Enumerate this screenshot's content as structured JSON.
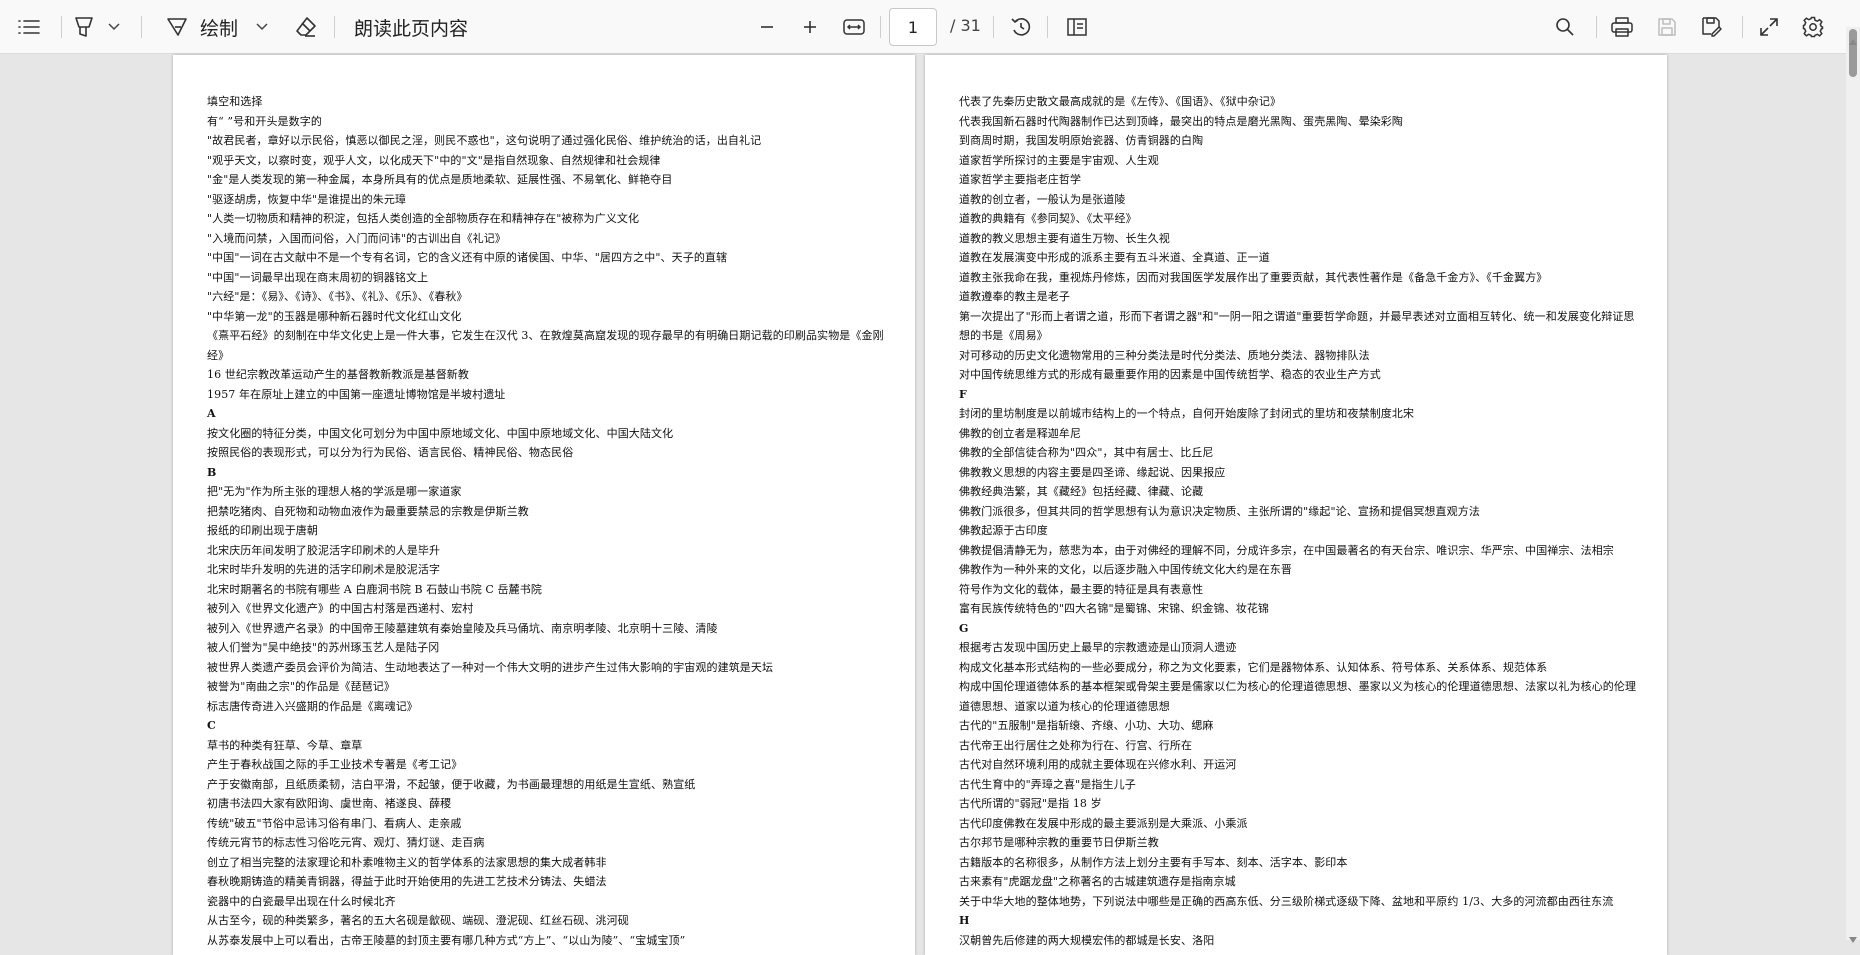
{
  "toolbar": {
    "draw_label": "绘制",
    "read_aloud_label": "朗读此页内容",
    "page_current": "1",
    "page_total": "/ 31"
  },
  "icons": [
    "contents-icon",
    "highlight-icon",
    "chevron-down-icon",
    "draw-icon",
    "chevron-down-icon",
    "eraser-icon",
    "zoom-out-icon",
    "zoom-in-icon",
    "fit-width-icon",
    "rotate-icon",
    "page-view-icon",
    "search-icon",
    "print-icon",
    "save-icon",
    "save-as-icon",
    "fullscreen-icon",
    "gear-icon"
  ],
  "left_page": {
    "lines": [
      {
        "text": "填空和选择"
      },
      {
        "text": "有“ ”号和开头是数字的"
      },
      {
        "text": "\"故君民者，章好以示民俗，慎恶以御民之淫，则民不惑也\"，这句说明了通过强化民俗、维护统治的话，出自礼记"
      },
      {
        "text": "\"观乎天文，以察时变，观乎人文，以化成天下\"中的\"文\"是指自然现象、自然规律和社会规律"
      },
      {
        "text": "\"金\"是人类发现的第一种金属，本身所具有的优点是质地柔软、延展性强、不易氧化、鲜艳夺目"
      },
      {
        "text": "\"驱逐胡虏，恢复中华\"是谁提出的朱元璋"
      },
      {
        "text": "\"人类一切物质和精神的积淀，包括人类创造的全部物质存在和精神存在\"被称为广义文化"
      },
      {
        "text": "\"入境而问禁，入国而问俗，入门而问讳\"的古训出自《礼记》"
      },
      {
        "text": "\"中国\"一词在古文献中不是一个专有名词，它的含义还有中原的诸侯国、中华、\"居四方之中\"、天子的直辖"
      },
      {
        "text": "\"中国\"一词最早出现在商末周初的铜器铭文上"
      },
      {
        "text": " \"六经\"是：《易》、《诗》、《书》、《礼》、《乐》、《春秋》"
      },
      {
        "text": " \"中华第一龙\"的玉器是哪种新石器时代文化红山文化"
      },
      {
        "text": "《熹平石经》的刻制在中华文化史上是一件大事，它发生在汉代 3、在敦煌莫高窟发现的现存最早的有明确日期记载的印刷品实物是《金刚经》",
        "wrap": true
      },
      {
        "text": "16 世纪宗教改革运动产生的基督教新教派是基督新教"
      },
      {
        "text": "1957 年在原址上建立的中国第一座遗址博物馆是半坡村遗址"
      },
      {
        "text": "A",
        "hdr": true
      },
      {
        "text": "按文化圈的特征分类，中国文化可划分为中国中原地域文化、中国中原地域文化、中国大陆文化"
      },
      {
        "text": "按照民俗的表现形式，可以分为行为民俗、语言民俗、精神民俗、物态民俗"
      },
      {
        "text": "B",
        "hdr": true
      },
      {
        "text": "把\"无为\"作为所主张的理想人格的学派是哪一家道家"
      },
      {
        "text": "把禁吃猪肉、自死物和动物血液作为最重要禁忌的宗教是伊斯兰教"
      },
      {
        "text": "报纸的印刷出现于唐朝"
      },
      {
        "text": "北宋庆历年间发明了胶泥活字印刷术的人是毕升"
      },
      {
        "text": "北宋时毕升发明的先进的活字印刷术是胶泥活字"
      },
      {
        "text": "北宋时期著名的书院有哪些 A 白鹿洞书院 B 石鼓山书院 C 岳麓书院"
      },
      {
        "text": "被列入《世界文化遗产》的中国古村落是西递村、宏村"
      },
      {
        "text": "被列入《世界遗产名录》的中国帝王陵墓建筑有秦始皇陵及兵马俑坑、南京明孝陵、北京明十三陵、清陵"
      },
      {
        "text": "被人们誉为\"吴中绝技\"的苏州琢玉艺人是陆子冈"
      },
      {
        "text": "被世界人类遗产委员会评价为简洁、生动地表达了一种对一个伟大文明的进步产生过伟大影响的宇宙观的建筑是天坛"
      },
      {
        "text": "被誉为\"南曲之宗\"的作品是《琵琶记》"
      },
      {
        "text": "标志唐传奇进入兴盛期的作品是《离魂记》"
      },
      {
        "text": "C",
        "hdr": true
      },
      {
        "text": "草书的种类有狂草、今草、章草"
      },
      {
        "text": "产生于春秋战国之际的手工业技术专著是《考工记》"
      },
      {
        "text": "产于安徽南部，且纸质柔韧，洁白平滑，不起皱，便于收藏，为书画最理想的用纸是生宣纸、熟宣纸"
      },
      {
        "text": "初唐书法四大家有欧阳询、虞世南、褚遂良、薛稷"
      },
      {
        "text": "传统\"破五\"节俗中忌讳习俗有串门、看病人、走亲戚"
      },
      {
        "text": "传统元宵节的标志性习俗吃元宵、观灯、猜灯谜、走百病"
      },
      {
        "text": "创立了相当完整的法家理论和朴素唯物主义的哲学体系的法家思想的集大成者韩非"
      },
      {
        "text": "春秋晚期铸造的精美青铜器，得益于此时开始使用的先进工艺技术分铸法、失蜡法"
      },
      {
        "text": "瓷器中的白瓷最早出现在什么时候北齐"
      },
      {
        "text": "从古至今，砚的种类繁多，著名的五大名砚是歙砚、端砚、澄泥砚、红丝石砚、洮河砚"
      },
      {
        "text": "从苏泰发展中上可以看出，古帝王陵墓的封顶主要有哪几种方式“方上”、“以山为陵”、“宝城宝顶”"
      }
    ]
  },
  "right_page": {
    "lines": [
      {
        "text": "代表了先秦历史散文最高成就的是《左传》、《国语》、《狱中杂记》"
      },
      {
        "text": "代表我国新石器时代陶器制作已达到顶峰，最突出的特点是磨光黑陶、蛋壳黑陶、晕染彩陶"
      },
      {
        "text": "到商周时期，我国发明原始瓷器、仿青铜器的白陶"
      },
      {
        "text": "道家哲学所探讨的主要是宇宙观、人生观"
      },
      {
        "text": "道家哲学主要指老庄哲学"
      },
      {
        "text": "道教的创立者，一般认为是张道陵"
      },
      {
        "text": "道教的典籍有《参同契》、《太平经》"
      },
      {
        "text": "道教的教义思想主要有道生万物、长生久视"
      },
      {
        "text": "道教在发展演变中形成的派系主要有五斗米道、全真道、正一道"
      },
      {
        "text": "道教主张我命在我，重视炼丹修炼，因而对我国医学发展作出了重要贡献，其代表性著作是《备急千金方》、《千金翼方》"
      },
      {
        "text": "道教遵奉的教主是老子"
      },
      {
        "text": "第一次提出了\"形而上者谓之道，形而下者谓之器\"和\"一阴一阳之谓道\"重要哲学命题，并最早表述对立面相互转化、统一和发展变化辩证思想的书是《周易》",
        "wrap": true
      },
      {
        "text": "对可移动的历史文化遗物常用的三种分类法是时代分类法、质地分类法、器物排队法"
      },
      {
        "text": "对中国传统思维方式的形成有最重要作用的因素是中国传统哲学、稳态的农业生产方式"
      },
      {
        "text": "F",
        "hdr": true
      },
      {
        "text": "封闭的里坊制度是以前城市结构上的一个特点，自何开始废除了封闭式的里坊和夜禁制度北宋"
      },
      {
        "text": "佛教的创立者是释迦牟尼"
      },
      {
        "text": "佛教的全部信徒合称为\"四众\"，其中有居士、比丘尼"
      },
      {
        "text": "佛教教义思想的内容主要是四圣谛、缘起说、因果报应"
      },
      {
        "text": "佛教经典浩繁，其《藏经》包括经藏、律藏、论藏"
      },
      {
        "text": "佛教门派很多，但其共同的哲学思想有认为意识决定物质、主张所谓的\"缘起\"论、宣扬和提倡冥想直观方法"
      },
      {
        "text": "佛教起源于古印度"
      },
      {
        "text": "佛教提倡清静无为，慈悲为本，由于对佛经的理解不同，分成许多宗，在中国最著名的有天台宗、唯识宗、华严宗、中国禅宗、法相宗"
      },
      {
        "text": "佛教作为一种外来的文化，以后逐步融入中国传统文化大约是在东晋"
      },
      {
        "text": "符号作为文化的载体，最主要的特征是具有表意性"
      },
      {
        "text": "富有民族传统特色的\"四大名锦\"是蜀锦、宋锦、织金锦、妆花锦"
      },
      {
        "text": "G",
        "hdr": true
      },
      {
        "text": "根据考古发现中国历史上最早的宗教遗迹是山顶洞人遗迹"
      },
      {
        "text": "构成文化基本形式结构的一些必要成分，称之为文化要素，它们是器物体系、认知体系、符号体系、关系体系、规范体系"
      },
      {
        "text": "构成中国伦理道德体系的基本框架或骨架主要是儒家以仁为核心的伦理道德思想、墨家以义为核心的伦理道德思想、法家以礼为核心的伦理道德思想、道家以道为核心的伦理道德思想",
        "wrap": true
      },
      {
        "text": "古代的\"五服制\"是指斩缞、齐缞、小功、大功、缌麻"
      },
      {
        "text": "古代帝王出行居住之处称为行在、行宫、行所在"
      },
      {
        "text": "古代对自然环境利用的成就主要体现在兴修水利、开运河"
      },
      {
        "text": "古代生育中的\"弄璋之喜\"是指生儿子"
      },
      {
        "text": "古代所谓的\"弱冠\"是指 18 岁"
      },
      {
        "text": "古代印度佛教在发展中形成的最主要派别是大乘派、小乘派"
      },
      {
        "text": "古尔邦节是哪种宗教的重要节日伊斯兰教"
      },
      {
        "text": "古籍版本的名称很多，从制作方法上划分主要有手写本、刻本、活字本、影印本"
      },
      {
        "text": "古来素有\"虎踞龙盘\"之称著名的古城建筑遗存是指南京城"
      },
      {
        "text": "关于中华大地的整体地势，下列说法中哪些是正确的西高东低、分三级阶梯式逐级下降、盆地和平原约 1/3、大多的河流都由西往东流"
      },
      {
        "text": "H",
        "hdr": true
      },
      {
        "text": "汉朝曾先后修建的两大规模宏伟的都城是长安、洛阳"
      }
    ]
  }
}
